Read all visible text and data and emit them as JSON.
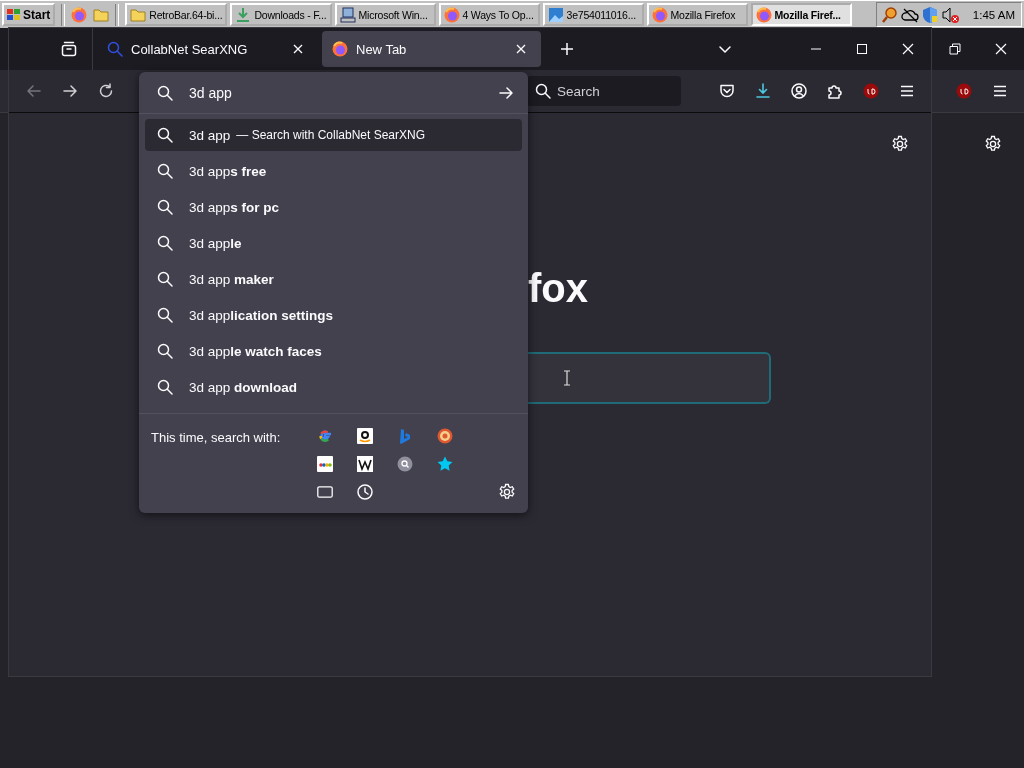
{
  "taskbar": {
    "start": "Start",
    "tasks": [
      {
        "label": "RetroBar.64-bi...",
        "selected": false
      },
      {
        "label": "Downloads - F...",
        "selected": false
      },
      {
        "label": "Microsoft Win...",
        "selected": false
      },
      {
        "label": "4 Ways To Op...",
        "selected": false
      },
      {
        "label": "3e754011016...",
        "selected": false
      },
      {
        "label": "Mozilla Firefox",
        "selected": false
      },
      {
        "label": "Mozilla Firef...",
        "selected": true
      }
    ],
    "clock": "1:45 AM"
  },
  "browser": {
    "tabs": [
      {
        "label": "CollabNet SearXNG",
        "selected": false
      },
      {
        "label": "New Tab",
        "selected": true
      }
    ],
    "navigation": [
      {
        "kind": "back",
        "disabled": true
      },
      {
        "kind": "forward",
        "disabled": false
      }
    ],
    "address_bar": {
      "value": "3d app"
    },
    "search_field": {
      "placeholder": "Search"
    },
    "suggestions": [
      {
        "text": "3d app",
        "action": "— Search with CollabNet SearXNG",
        "selected": true
      },
      {
        "text": "3d app**s free**",
        "selected": false
      },
      {
        "text": "3d app**s for pc**",
        "selected": false
      },
      {
        "text": "3d app**le**",
        "selected": false
      },
      {
        "text": "3d app **maker**",
        "selected": false
      },
      {
        "text": "3d app**lication settings**",
        "selected": false
      },
      {
        "text": "3d app**le watch faces**",
        "selected": false
      },
      {
        "text": "3d app **download**",
        "selected": false
      }
    ],
    "search_with_label": "This time, search with:",
    "page": {
      "heading": "fox"
    }
  }
}
